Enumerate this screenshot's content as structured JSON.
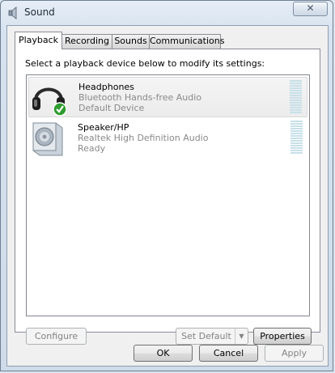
{
  "window": {
    "title": "Sound",
    "close_glyph": "✕"
  },
  "tabs": [
    {
      "label": "Playback",
      "active": true
    },
    {
      "label": "Recording",
      "active": false
    },
    {
      "label": "Sounds",
      "active": false
    },
    {
      "label": "Communications",
      "active": false
    }
  ],
  "instruction": "Select a playback device below to modify its settings:",
  "devices": [
    {
      "name": "Headphones",
      "description": "Bluetooth Hands-free Audio",
      "status": "Default Device",
      "icon": "headphones-icon",
      "is_default": true,
      "selected": true
    },
    {
      "name": "Speaker/HP",
      "description": "Realtek High Definition Audio",
      "status": "Ready",
      "icon": "speaker-icon",
      "is_default": false,
      "selected": false
    }
  ],
  "panel_buttons": {
    "configure": "Configure",
    "set_default": "Set Default",
    "properties": "Properties"
  },
  "dialog_buttons": {
    "ok": "OK",
    "cancel": "Cancel",
    "apply": "Apply"
  },
  "colors": {
    "accent_check": "#2e9b2e",
    "meter": "#c8e0e8",
    "disabled_text": "#838383"
  }
}
